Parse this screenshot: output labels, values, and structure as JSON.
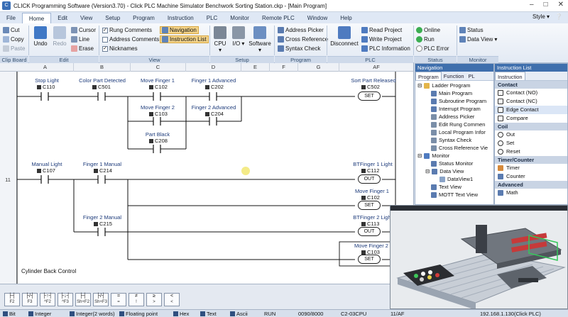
{
  "window": {
    "title": "CLICK Programming Software (Version3.70) - Click PLC Machine Simulator Benchwork Sorting Station.ckp - [Main Program]"
  },
  "menu": {
    "items": [
      "File",
      "Home",
      "Edit",
      "View",
      "Setup",
      "Program",
      "Instruction",
      "PLC",
      "Monitor",
      "Remote PLC",
      "Window",
      "Help"
    ],
    "style_label": "Style"
  },
  "ribbon": {
    "clipboard": {
      "cut": "Cut",
      "copy": "Copy",
      "paste": "Paste",
      "group": "Clip Board"
    },
    "edit": {
      "undo": "Undo",
      "redo": "Redo",
      "cursor": "Cursor",
      "line": "Line",
      "erase": "Erase",
      "group": "Edit"
    },
    "view": {
      "rung_comments": "Rung Comments",
      "address_comments": "Address Comments",
      "nicknames": "Nicknames",
      "navigation": "Navigation",
      "instruction_list": "Instruction List",
      "group": "View"
    },
    "setup": {
      "cpu": "CPU",
      "io": "I/O",
      "software": "Software",
      "group": "Setup"
    },
    "program": {
      "address_picker": "Address Picker",
      "cross_reference": "Cross Reference",
      "syntax_check": "Syntax Check",
      "group": "Program"
    },
    "plc": {
      "disconnect": "Disconnect",
      "read_project": "Read Project",
      "write_project": "Write Project",
      "plc_information": "PLC Information",
      "online": "Online",
      "run": "Run",
      "plc_error": "PLC Error",
      "group": "PLC"
    },
    "status_group": {
      "label": "Status"
    },
    "monitor": {
      "status": "Status",
      "data_view": "Data View",
      "group": "Monitor"
    }
  },
  "ladder": {
    "columns": [
      "A",
      "B",
      "C",
      "D",
      "E",
      "F",
      "G",
      "AF"
    ],
    "rung_numbers": [
      "11"
    ],
    "contacts": [
      {
        "label": "Stop Light",
        "address": "C110"
      },
      {
        "label": "Color Part Detected",
        "address": "C501"
      },
      {
        "label": "Move Finger 1",
        "address": "C102"
      },
      {
        "label": "Finger 1 Advanced",
        "address": "C202"
      },
      {
        "label": "Move Finger 2",
        "address": "C103"
      },
      {
        "label": "Finger 2 Advanced",
        "address": "C204"
      },
      {
        "label": "Part Black",
        "address": "C208"
      },
      {
        "label": "Manual Light",
        "address": "C107"
      },
      {
        "label": "Finger 1 Manual",
        "address": "C214"
      },
      {
        "label": "Finger 2 Manual",
        "address": "C215"
      }
    ],
    "coils": [
      {
        "label": "Sort Part Released",
        "address": "C502",
        "type": "SET"
      },
      {
        "label": "BTFinger 1 Light",
        "address": "C112",
        "type": "OUT"
      },
      {
        "label": "Move Finger 1",
        "address": "C102",
        "type": "SET"
      },
      {
        "label": "BTFinger 2 Light",
        "address": "C113",
        "type": "OUT"
      },
      {
        "label": "Move Finger 2",
        "address": "C103",
        "type": "SET"
      }
    ],
    "rung_comment": "Cylinder Back Control"
  },
  "navigation": {
    "title": "Navigation",
    "tabs": [
      "Program",
      "Function",
      "PL"
    ],
    "items": [
      "Ladder Program",
      "Main Program",
      "Subroutine Program",
      "Interrupt Program",
      "Address Picker",
      "Edit Rung Commen",
      "Local Program Infor",
      "Syntax Check",
      "Cross Reference Vie",
      "Monitor",
      "Status Monitor",
      "Data View",
      "DataView1",
      "Text View",
      "MOTT Text View"
    ]
  },
  "instruction_list": {
    "title": "Instruction List",
    "tab": "Instruction",
    "categories": [
      {
        "name": "Contact",
        "items": [
          "Contact (NO)",
          "Contact (NC)",
          "Edge Contact",
          "Compare"
        ]
      },
      {
        "name": "Coil",
        "items": [
          "Out",
          "Set",
          "Reset"
        ]
      },
      {
        "name": "Timer/Counter",
        "items": [
          "Timer",
          "Counter"
        ]
      },
      {
        "name": "Advanced",
        "items": [
          "Math"
        ]
      }
    ]
  },
  "strip": {
    "keys": [
      "F2",
      "F3",
      "^F2",
      "^F3",
      "Sh+F2",
      "Sh+F3",
      "=",
      "!",
      ">",
      "<"
    ]
  },
  "statusbar": {
    "bit": "Bit",
    "integer": "Integer",
    "integer2": "Integer(2 words)",
    "float": "Floating point",
    "hex": "Hex",
    "text": "Text",
    "ascii": "Ascii",
    "run": "RUN",
    "steps": "0090/8000",
    "cpu": "C2-03CPU",
    "position": "11/AF",
    "ip": "192.168.1.130(Click PLC)"
  },
  "colors": {
    "accent": "#3f6fad",
    "rung_line": "#111111"
  }
}
